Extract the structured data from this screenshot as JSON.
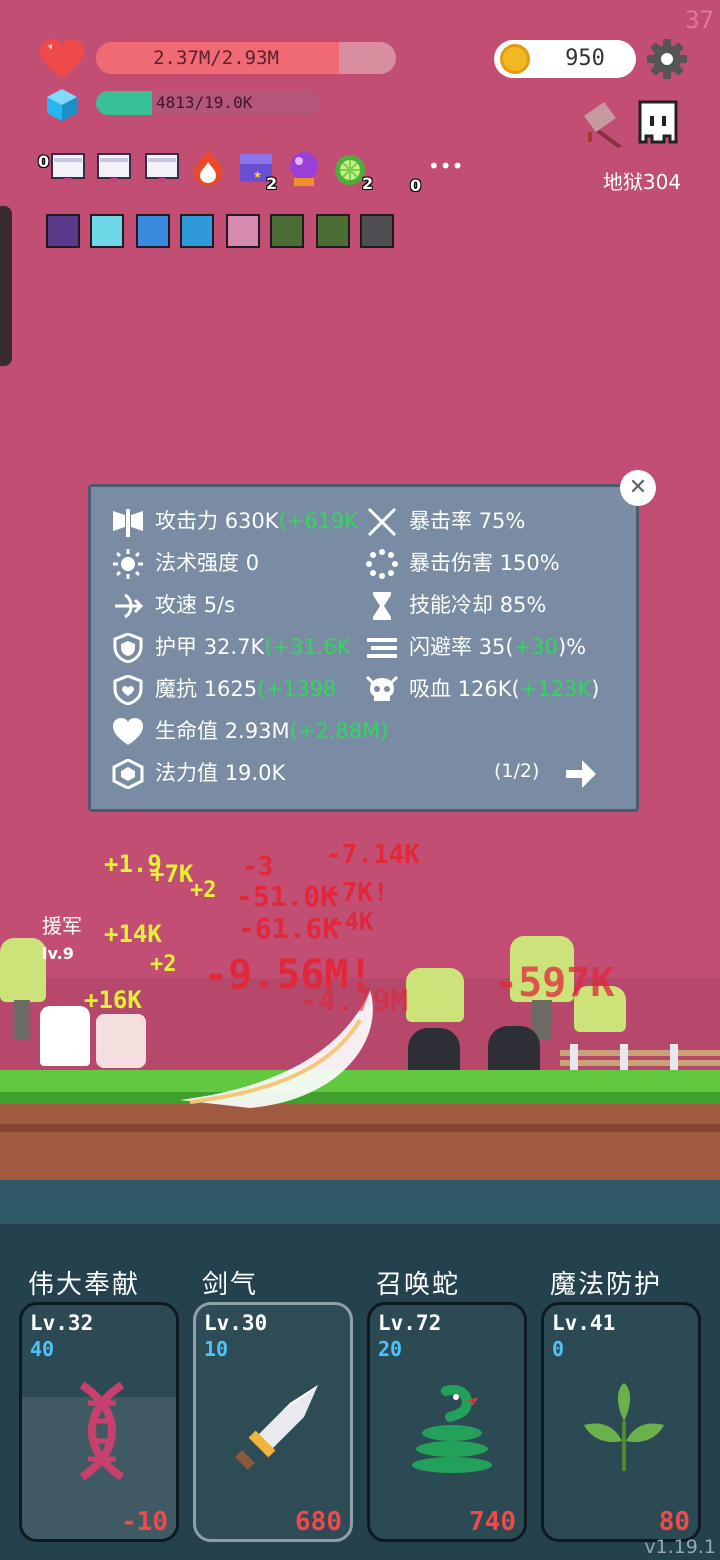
{
  "fps": "37",
  "hud": {
    "hp_text": "2.37M/2.93M",
    "hp_fraction": 0.81,
    "mp_text": "4813/19.0K",
    "mp_fraction": 0.25,
    "coins": "950",
    "level_label": "地狱304"
  },
  "items": [
    {
      "icon": "scroll-icon",
      "count": "0"
    },
    {
      "icon": "scroll-icon",
      "count": ""
    },
    {
      "icon": "scroll-icon",
      "count": ""
    },
    {
      "icon": "flame-icon",
      "count": ""
    },
    {
      "icon": "chest-icon",
      "count": "2"
    },
    {
      "icon": "crystal-ball-icon",
      "count": ""
    },
    {
      "icon": "lime-icon",
      "count": "2"
    },
    {
      "icon": "more-icon",
      "count": "0"
    }
  ],
  "more_label": "•••",
  "stats": {
    "left": [
      {
        "label": "攻击力",
        "value": "630K",
        "bonus": "(+619K"
      },
      {
        "label": "法术强度",
        "value": "0",
        "bonus": ""
      },
      {
        "label": "攻速",
        "value": "5/s",
        "bonus": ""
      },
      {
        "label": "护甲",
        "value": "32.7K",
        "bonus": "(+31.6K"
      },
      {
        "label": "魔抗",
        "value": "1625",
        "bonus": "(+1398"
      },
      {
        "label": "生命值",
        "value": "2.93M",
        "bonus": "(+2.88M)"
      },
      {
        "label": "法力值",
        "value": "19.0K",
        "bonus": ""
      }
    ],
    "right": [
      {
        "label": "暴击率",
        "value": "75%",
        "bonus": "",
        "suffix": ""
      },
      {
        "label": "暴击伤害",
        "value": "150%",
        "bonus": "",
        "suffix": ""
      },
      {
        "label": "技能冷却",
        "value": "85%",
        "bonus": "",
        "suffix": ""
      },
      {
        "label": "闪避率",
        "value": "35(",
        "bonus": "+30",
        "suffix": ")%"
      },
      {
        "label": "吸血",
        "value": "126K(",
        "bonus": "+123K",
        "suffix": ")"
      }
    ],
    "page": "(1/2)",
    "close": "✕"
  },
  "battle": {
    "hero_label": "援军",
    "hero_lv": "lv.9",
    "damage_red": [
      "-7.14K",
      "-3",
      "-51.0K",
      "-7K!",
      "-61.6K",
      "-4K",
      "-9.56M!",
      "-4.79M",
      "-597K"
    ],
    "damage_yellow": [
      "+1.9",
      "+7K",
      "+2",
      "+14K",
      "+2",
      "+16K"
    ]
  },
  "cards": [
    {
      "name": "伟大奉献",
      "lv": "Lv.32",
      "count": "40",
      "cost": "-10",
      "icon": "dna-icon"
    },
    {
      "name": "剑气",
      "lv": "Lv.30",
      "count": "10",
      "cost": "680",
      "icon": "sword-icon"
    },
    {
      "name": "召唤蛇",
      "lv": "Lv.72",
      "count": "20",
      "cost": "740",
      "icon": "snake-icon"
    },
    {
      "name": "魔法防护",
      "lv": "Lv.41",
      "count": "0",
      "cost": "80",
      "icon": "leaf-icon"
    }
  ],
  "version": "v1.19.1"
}
